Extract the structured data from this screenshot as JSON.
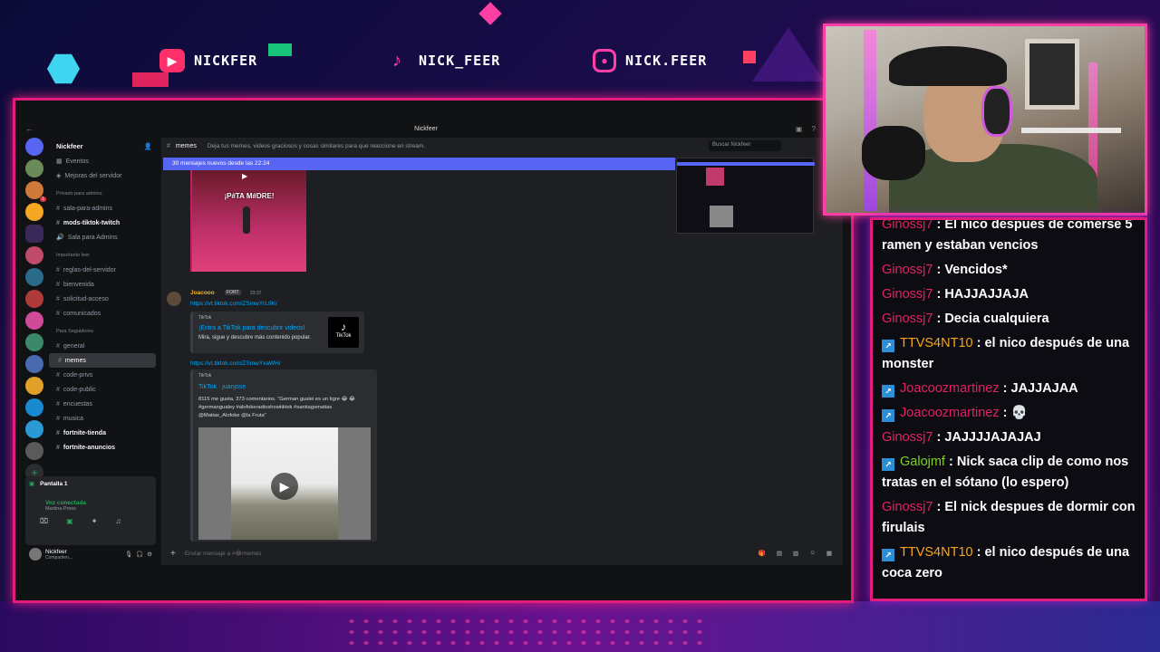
{
  "socials": {
    "youtube": {
      "icon": "youtube-icon",
      "name": "NICKFER"
    },
    "tiktok": {
      "icon": "tiktok-icon",
      "name": "NICK_FEER"
    },
    "instagram": {
      "icon": "instagram-icon",
      "name": "NICK.FEER"
    }
  },
  "discord": {
    "window_title": "Nickfeer",
    "server_name": "Nickfeer",
    "nav": [
      "Eventos",
      "Mejoras del servidor"
    ],
    "categories": [
      {
        "name": "Privado para admins",
        "channels": [
          "sala-para-admins",
          "mods-tiktok-twitch",
          "Sala para Admins"
        ]
      },
      {
        "name": "Importante leer",
        "channels": [
          "reglas-del-servidor",
          "bienvenida",
          "solicitud-acceso",
          "comunicados"
        ]
      },
      {
        "name": "Para Seguidores",
        "channels": [
          "general",
          "memes",
          "code-privs",
          "code-public",
          "encuestas",
          "musica",
          "fortnite-tienda",
          "fortnite-anuncios"
        ]
      }
    ],
    "channel": {
      "name": "memes",
      "topic": "Deja tus memes, videos graciosos y cosas similares para que reaccione en stream.",
      "search_placeholder": "Buscar Nickfeer"
    },
    "new_messages_bar": "30 mensajes nuevos desde las 22:24",
    "meme_caption": "¡P#TA M#DRE!",
    "message": {
      "author": "Joacooo",
      "tag": "FORT",
      "time": "23:37",
      "link1": "https://vt.tiktok.com/ZSmwYrL9K/",
      "embed1": {
        "provider": "TikTok",
        "title": "¡Entra a TikTok para descubrir videos!",
        "description": "Mira, sigue y descubre más contenido popular.",
        "logo_text": "TikTok"
      },
      "link2": "https://vt.tiktok.com/ZSmwYxaWH/",
      "embed2": {
        "provider": "TikTok",
        "title": "TikTok · juanjose",
        "description": "8115 me gusta, 373 comentarios. \"German gualei es un tigre 😂 😂 #germangualey #alofokeradioshowtiktok #santiagomatias @Matias_Alofoke @la Fruta\""
      }
    },
    "voice": {
      "screen_label": "Pantalla 1",
      "status": "Voz conectada",
      "channel": "Martina Press"
    },
    "user": {
      "name": "Nickfeer",
      "status": "Compartien..."
    },
    "composer_placeholder": "Enviar mensaje a #😂memes"
  },
  "chat": [
    {
      "user": "Ginossj7",
      "color": "#e0245e",
      "text": "El nico despues de comerse 5 ramen y estaban vencios",
      "prime": false
    },
    {
      "user": "Ginossj7",
      "color": "#e0245e",
      "text": "Vencidos*",
      "prime": false
    },
    {
      "user": "Ginossj7",
      "color": "#e0245e",
      "text": "HAJJAJJAJA",
      "prime": false
    },
    {
      "user": "Ginossj7",
      "color": "#e0245e",
      "text": "Decia cualquiera",
      "prime": false
    },
    {
      "user": "TTVS4NT10",
      "color": "#f5a623",
      "text": "el nico después de una monster",
      "prime": true
    },
    {
      "user": "Joacoozmartinez",
      "color": "#e0245e",
      "text": "JAJJAJAA",
      "prime": true
    },
    {
      "user": "Joacoozmartinez",
      "color": "#e0245e",
      "text": "💀",
      "prime": true
    },
    {
      "user": "Ginossj7",
      "color": "#e0245e",
      "text": "JAJJJJAJAJAJ",
      "prime": false
    },
    {
      "user": "Galojmf",
      "color": "#7ed321",
      "text": "Nick saca clip de como nos tratas en el sótano (lo espero)",
      "prime": true
    },
    {
      "user": "Ginossj7",
      "color": "#e0245e",
      "text": "El nick despues de dormir con firulais",
      "prime": false
    },
    {
      "user": "TTVS4NT10",
      "color": "#f5a623",
      "text": "el nico después de una coca zero",
      "prime": true
    }
  ]
}
